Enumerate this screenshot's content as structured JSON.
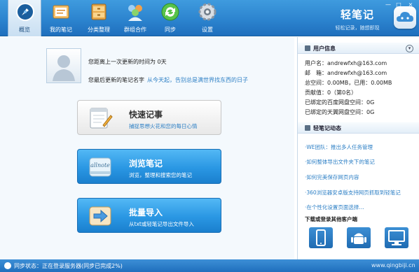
{
  "toolbar": {
    "items": [
      {
        "label": "概览",
        "icon": "overview-icon"
      },
      {
        "label": "我的笔记",
        "icon": "my-notes-icon"
      },
      {
        "label": "分类整理",
        "icon": "categorize-icon"
      },
      {
        "label": "群组合作",
        "icon": "group-icon"
      },
      {
        "label": "同步",
        "icon": "sync-icon"
      },
      {
        "label": "设置",
        "icon": "settings-icon"
      }
    ]
  },
  "brand": {
    "name": "轻笔记",
    "tagline": "轻松记录，随想即现"
  },
  "window_controls": [
    "—",
    "□",
    "×"
  ],
  "main": {
    "last_update_text": "您距离上一次更新的时间为 0天",
    "last_note_label": "您最后更新的笔记名字",
    "last_note_name": "从今天起，告别总是满世界找东西的日子"
  },
  "buttons": {
    "quick": {
      "title": "快速记事",
      "subtitle": "捕捉思想火花和您的每日心情"
    },
    "browse": {
      "title": "浏览笔记",
      "subtitle": "浏览，整理和搜索您的笔记",
      "icon_text": "allnote"
    },
    "import": {
      "title": "批量导入",
      "subtitle": "从txt或轻笔记导出文件导入"
    }
  },
  "user_info": {
    "heading": "用户信息",
    "rows": [
      "用户名：andrewfxh@163.com",
      "邮　箱：andrewfxh@163.com",
      "总空间：0.00MB，已用：0.00MB",
      "贡献值：0（第0名）",
      "已绑定的百度网盘空间：0G",
      "已绑定的天翼网盘空间：0G"
    ]
  },
  "news": {
    "heading": "轻笔记动态",
    "items": [
      "·WE团队：推出多人任务管理",
      "·如何整体导出文件夹下的笔记",
      "·如何完美保存网页内容",
      "·360浏览器安卓版支持网页抓取到轻笔记",
      "·在个性化设置页面选择…"
    ]
  },
  "download": {
    "heading": "下载或登录其他客户端"
  },
  "status": {
    "text": "同步状态：正在登录服务器(同步已完成2%)",
    "watermark": "www.qingbiji.cn"
  }
}
